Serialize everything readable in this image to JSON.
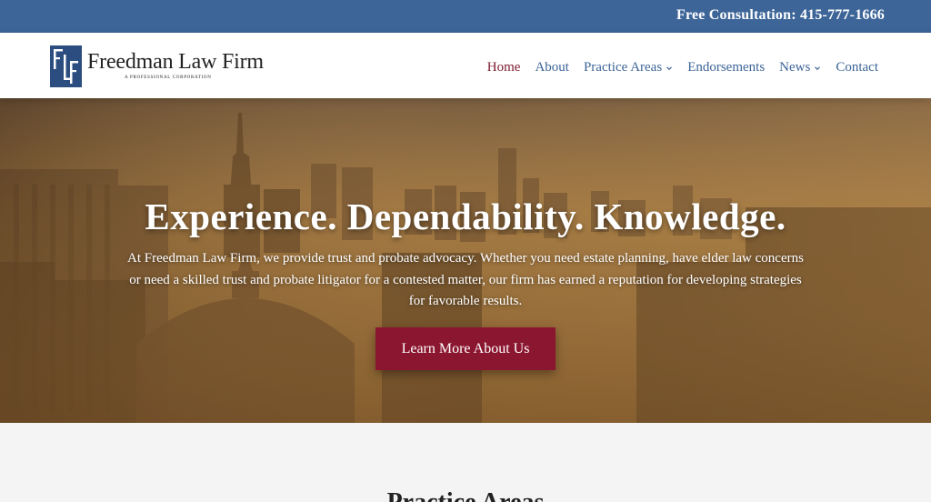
{
  "topbar": {
    "consultation": "Free Consultation: 415-777-1666",
    "background_color": "#3d6598"
  },
  "header": {
    "logo": {
      "monogram": "FLF",
      "name": "Freedman Law Firm",
      "subtitle": "A PROFESSIONAL CORPORATION"
    },
    "nav": [
      {
        "label": "Home",
        "active": true,
        "has_dropdown": false
      },
      {
        "label": "About",
        "active": false,
        "has_dropdown": false
      },
      {
        "label": "Practice Areas",
        "active": false,
        "has_dropdown": true
      },
      {
        "label": "Endorsements",
        "active": false,
        "has_dropdown": false
      },
      {
        "label": "News",
        "active": false,
        "has_dropdown": true
      },
      {
        "label": "Contact",
        "active": false,
        "has_dropdown": false
      }
    ],
    "nav_color": "#3d6598",
    "active_color": "#7b1a2e"
  },
  "hero": {
    "title": "Experience. Dependability. Knowledge.",
    "text": "At Freedman Law Firm, we provide trust and probate advocacy. Whether you need estate planning, have elder law concerns or need a skilled trust and probate litigator for a contested matter, our firm has earned a reputation for developing strategies for favorable results.",
    "button_label": "Learn More About Us",
    "button_color": "#8b1630"
  },
  "section": {
    "title": "Practice Areas"
  }
}
